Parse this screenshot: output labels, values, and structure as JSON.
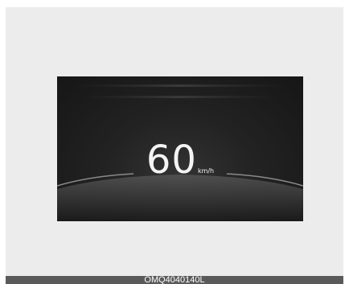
{
  "display": {
    "speed": "60",
    "unit": "km/h"
  },
  "caption": {
    "code": "OMQ4040140L"
  },
  "colors": {
    "background": "#ececec",
    "screen": "#1e1e1e",
    "readout": "#f4f4f4",
    "caption_bar": "#5a5a5a"
  }
}
